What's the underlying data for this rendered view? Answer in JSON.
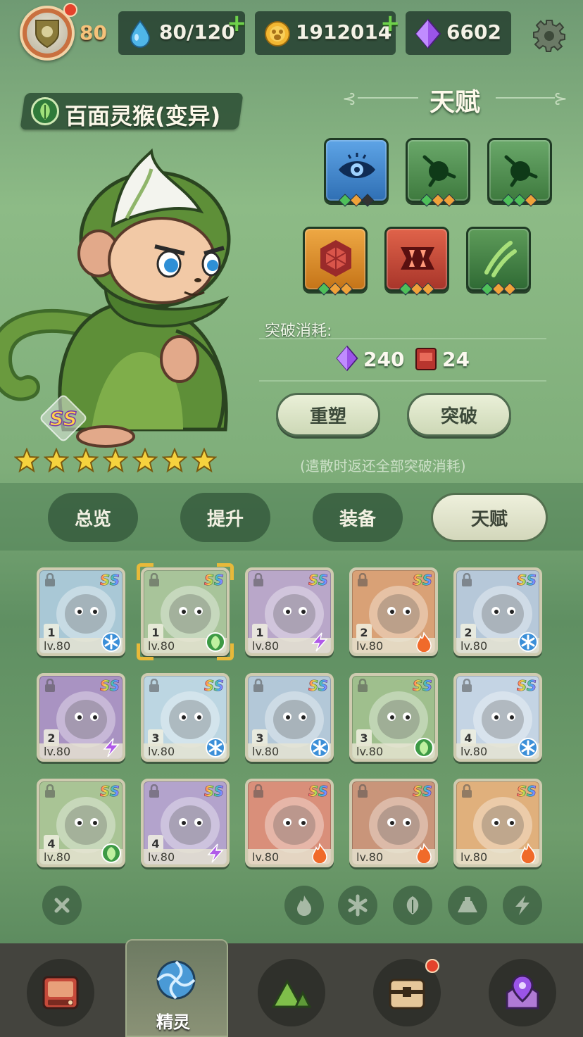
{
  "top_bar": {
    "player_level": "80",
    "stamina": "80/120",
    "coins": "1912014",
    "gems": "6602",
    "stamina_plus": "+",
    "coins_plus": "+"
  },
  "pet": {
    "name": "百面灵猴(变异)",
    "grade": "SS",
    "stars": 7,
    "element": "leaf-icon"
  },
  "talent": {
    "title": "天赋",
    "slots": [
      {
        "icon": "eye-icon",
        "color": "#3d7fc4",
        "diamonds": [
          "green",
          "orange",
          "dark"
        ]
      },
      {
        "icon": "thorn-orb-icon",
        "color": "#3f8a3e",
        "diamonds": [
          "green",
          "orange",
          "orange"
        ]
      },
      {
        "icon": "thorn-orb-icon",
        "color": "#3f8a3e",
        "diamonds": [
          "green",
          "green",
          "orange"
        ]
      },
      {
        "icon": "hexagon-shield-icon",
        "color": "#d98a2b",
        "diamonds": [
          "green",
          "orange",
          "orange"
        ]
      },
      {
        "icon": "fangs-icon",
        "color": "#c9503a",
        "diamonds": [
          "green",
          "orange",
          "orange"
        ]
      },
      {
        "icon": "claw-slash-icon",
        "color": "#3d7f45",
        "diamonds": [
          "green",
          "orange",
          "orange"
        ]
      }
    ],
    "cost_label": "突破消耗:",
    "cost_gems": "240",
    "cost_books": "24",
    "reshape_button": "重塑",
    "breakthrough_button": "突破",
    "note": "(遣散时返还全部突破消耗)"
  },
  "tabs": [
    {
      "label": "总览",
      "active": false
    },
    {
      "label": "提升",
      "active": false
    },
    {
      "label": "装备",
      "active": false
    },
    {
      "label": "天赋",
      "active": true
    }
  ],
  "pets": [
    {
      "grade": "SS",
      "rank": "1",
      "level": "lv.80",
      "element": "ice",
      "bg": "#a9c8d6",
      "face": "blue-deer"
    },
    {
      "grade": "SS",
      "rank": "1",
      "level": "lv.80",
      "element": "leaf",
      "bg": "#a8c49a",
      "face": "green-monkey",
      "selected": true
    },
    {
      "grade": "SS",
      "rank": "1",
      "level": "lv.80",
      "element": "thunder",
      "bg": "#b9a7c9",
      "face": "purple-mouse"
    },
    {
      "grade": "SS",
      "rank": "2",
      "level": "lv.80",
      "element": "fire",
      "bg": "#d9a176",
      "face": "fire-imp"
    },
    {
      "grade": "SS",
      "rank": "2",
      "level": "lv.80",
      "element": "ice",
      "bg": "#b6c8d9",
      "face": "crane"
    },
    {
      "grade": "SS",
      "rank": "2",
      "level": "lv.80",
      "element": "thunder",
      "bg": "#a993c2",
      "face": "purple-unicorn"
    },
    {
      "grade": "SS",
      "rank": "3",
      "level": "lv.80",
      "element": "ice",
      "bg": "#bcd6e2",
      "face": "ice-rabbit"
    },
    {
      "grade": "SS",
      "rank": "3",
      "level": "lv.80",
      "element": "ice",
      "bg": "#b3c8d8",
      "face": "owl"
    },
    {
      "grade": "SS",
      "rank": "3",
      "level": "lv.80",
      "element": "leaf",
      "bg": "#9fbf8d",
      "face": "hooded-shade"
    },
    {
      "grade": "SS",
      "rank": "4",
      "level": "lv.80",
      "element": "ice",
      "bg": "#c4d4e4",
      "face": "ice-knight"
    },
    {
      "grade": "SS",
      "rank": "4",
      "level": "lv.80",
      "element": "leaf",
      "bg": "#a9c495",
      "face": "green-wolf"
    },
    {
      "grade": "SS",
      "rank": "4",
      "level": "lv.80",
      "element": "thunder",
      "bg": "#b3a3cc",
      "face": "purple-pig"
    },
    {
      "grade": "SS",
      "rank": "",
      "level": "lv.80",
      "element": "fire",
      "bg": "#d98f7a",
      "face": "red-ogre"
    },
    {
      "grade": "SS",
      "rank": "",
      "level": "lv.80",
      "element": "fire",
      "bg": "#c9957a",
      "face": "furnace-golem"
    },
    {
      "grade": "SS",
      "rank": "",
      "level": "lv.80",
      "element": "fire",
      "bg": "#e0b07c",
      "face": "fox"
    }
  ],
  "filters": [
    "clear-filter-icon",
    "fire-filter-icon",
    "ice-filter-icon",
    "leaf-filter-icon",
    "earth-filter-icon",
    "thunder-filter-icon"
  ],
  "bottom_nav": {
    "items": [
      "backpack-icon",
      "spirit-icon",
      "mountain-icon",
      "chest-icon",
      "map-pin-icon"
    ],
    "active_label": "精灵"
  },
  "colors": {
    "accent_gold": "#e8b93a",
    "plus_green": "#6fd14b",
    "notify_red": "#e4432c"
  }
}
